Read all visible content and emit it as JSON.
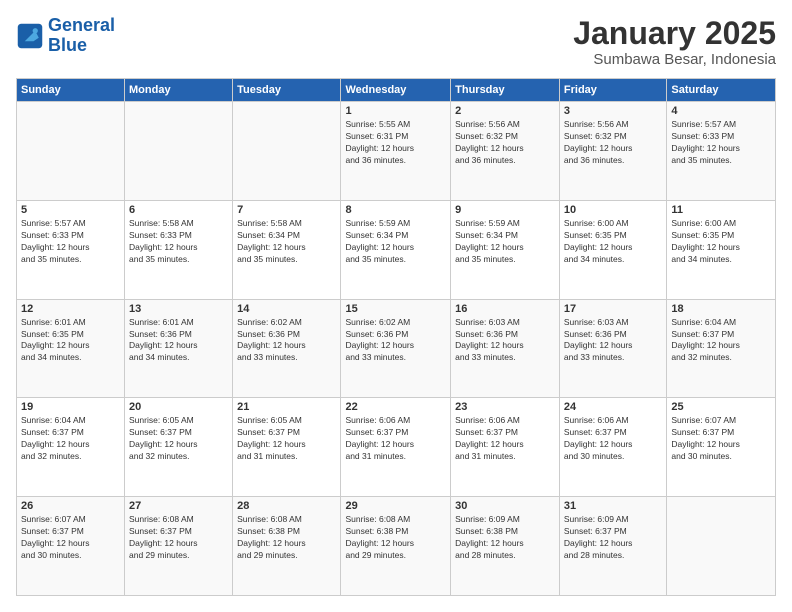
{
  "header": {
    "logo_line1": "General",
    "logo_line2": "Blue",
    "title": "January 2025",
    "subtitle": "Sumbawa Besar, Indonesia"
  },
  "weekdays": [
    "Sunday",
    "Monday",
    "Tuesday",
    "Wednesday",
    "Thursday",
    "Friday",
    "Saturday"
  ],
  "weeks": [
    [
      {
        "day": "",
        "info": ""
      },
      {
        "day": "",
        "info": ""
      },
      {
        "day": "",
        "info": ""
      },
      {
        "day": "1",
        "info": "Sunrise: 5:55 AM\nSunset: 6:31 PM\nDaylight: 12 hours\nand 36 minutes."
      },
      {
        "day": "2",
        "info": "Sunrise: 5:56 AM\nSunset: 6:32 PM\nDaylight: 12 hours\nand 36 minutes."
      },
      {
        "day": "3",
        "info": "Sunrise: 5:56 AM\nSunset: 6:32 PM\nDaylight: 12 hours\nand 36 minutes."
      },
      {
        "day": "4",
        "info": "Sunrise: 5:57 AM\nSunset: 6:33 PM\nDaylight: 12 hours\nand 35 minutes."
      }
    ],
    [
      {
        "day": "5",
        "info": "Sunrise: 5:57 AM\nSunset: 6:33 PM\nDaylight: 12 hours\nand 35 minutes."
      },
      {
        "day": "6",
        "info": "Sunrise: 5:58 AM\nSunset: 6:33 PM\nDaylight: 12 hours\nand 35 minutes."
      },
      {
        "day": "7",
        "info": "Sunrise: 5:58 AM\nSunset: 6:34 PM\nDaylight: 12 hours\nand 35 minutes."
      },
      {
        "day": "8",
        "info": "Sunrise: 5:59 AM\nSunset: 6:34 PM\nDaylight: 12 hours\nand 35 minutes."
      },
      {
        "day": "9",
        "info": "Sunrise: 5:59 AM\nSunset: 6:34 PM\nDaylight: 12 hours\nand 35 minutes."
      },
      {
        "day": "10",
        "info": "Sunrise: 6:00 AM\nSunset: 6:35 PM\nDaylight: 12 hours\nand 34 minutes."
      },
      {
        "day": "11",
        "info": "Sunrise: 6:00 AM\nSunset: 6:35 PM\nDaylight: 12 hours\nand 34 minutes."
      }
    ],
    [
      {
        "day": "12",
        "info": "Sunrise: 6:01 AM\nSunset: 6:35 PM\nDaylight: 12 hours\nand 34 minutes."
      },
      {
        "day": "13",
        "info": "Sunrise: 6:01 AM\nSunset: 6:36 PM\nDaylight: 12 hours\nand 34 minutes."
      },
      {
        "day": "14",
        "info": "Sunrise: 6:02 AM\nSunset: 6:36 PM\nDaylight: 12 hours\nand 33 minutes."
      },
      {
        "day": "15",
        "info": "Sunrise: 6:02 AM\nSunset: 6:36 PM\nDaylight: 12 hours\nand 33 minutes."
      },
      {
        "day": "16",
        "info": "Sunrise: 6:03 AM\nSunset: 6:36 PM\nDaylight: 12 hours\nand 33 minutes."
      },
      {
        "day": "17",
        "info": "Sunrise: 6:03 AM\nSunset: 6:36 PM\nDaylight: 12 hours\nand 33 minutes."
      },
      {
        "day": "18",
        "info": "Sunrise: 6:04 AM\nSunset: 6:37 PM\nDaylight: 12 hours\nand 32 minutes."
      }
    ],
    [
      {
        "day": "19",
        "info": "Sunrise: 6:04 AM\nSunset: 6:37 PM\nDaylight: 12 hours\nand 32 minutes."
      },
      {
        "day": "20",
        "info": "Sunrise: 6:05 AM\nSunset: 6:37 PM\nDaylight: 12 hours\nand 32 minutes."
      },
      {
        "day": "21",
        "info": "Sunrise: 6:05 AM\nSunset: 6:37 PM\nDaylight: 12 hours\nand 31 minutes."
      },
      {
        "day": "22",
        "info": "Sunrise: 6:06 AM\nSunset: 6:37 PM\nDaylight: 12 hours\nand 31 minutes."
      },
      {
        "day": "23",
        "info": "Sunrise: 6:06 AM\nSunset: 6:37 PM\nDaylight: 12 hours\nand 31 minutes."
      },
      {
        "day": "24",
        "info": "Sunrise: 6:06 AM\nSunset: 6:37 PM\nDaylight: 12 hours\nand 30 minutes."
      },
      {
        "day": "25",
        "info": "Sunrise: 6:07 AM\nSunset: 6:37 PM\nDaylight: 12 hours\nand 30 minutes."
      }
    ],
    [
      {
        "day": "26",
        "info": "Sunrise: 6:07 AM\nSunset: 6:37 PM\nDaylight: 12 hours\nand 30 minutes."
      },
      {
        "day": "27",
        "info": "Sunrise: 6:08 AM\nSunset: 6:37 PM\nDaylight: 12 hours\nand 29 minutes."
      },
      {
        "day": "28",
        "info": "Sunrise: 6:08 AM\nSunset: 6:38 PM\nDaylight: 12 hours\nand 29 minutes."
      },
      {
        "day": "29",
        "info": "Sunrise: 6:08 AM\nSunset: 6:38 PM\nDaylight: 12 hours\nand 29 minutes."
      },
      {
        "day": "30",
        "info": "Sunrise: 6:09 AM\nSunset: 6:38 PM\nDaylight: 12 hours\nand 28 minutes."
      },
      {
        "day": "31",
        "info": "Sunrise: 6:09 AM\nSunset: 6:37 PM\nDaylight: 12 hours\nand 28 minutes."
      },
      {
        "day": "",
        "info": ""
      }
    ]
  ]
}
